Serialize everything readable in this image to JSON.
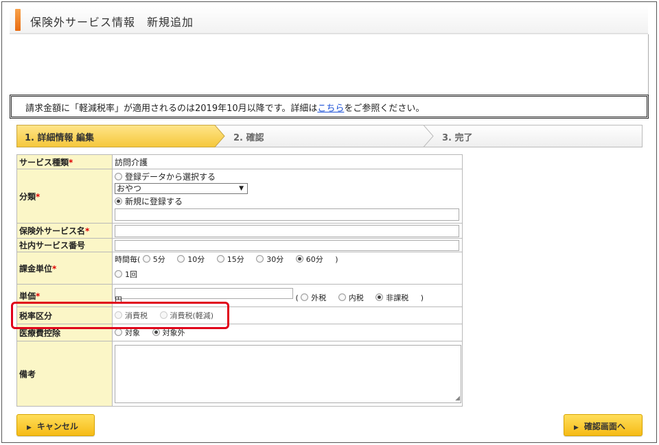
{
  "header": {
    "title": "保険外サービス情報　新規追加"
  },
  "notice": {
    "before_link": "請求金額に「軽減税率」が適用されるのは2019年10月以降です。詳細は",
    "link_text": "こちら",
    "after_link": "をご参照ください。"
  },
  "steps": [
    {
      "label": "1. 詳細情報 編集",
      "state": "active"
    },
    {
      "label": "2. 確認",
      "state": "inactive"
    },
    {
      "label": "3. 完了",
      "state": "inactive"
    }
  ],
  "form": {
    "service_type": {
      "label": "サービス種類",
      "required_mark": "*",
      "value": "訪問介護"
    },
    "category": {
      "label": "分類",
      "required_mark": "*",
      "option_select_existing": "登録データから選択する",
      "selected_value": "おやつ",
      "option_register_new": "新規に登録する",
      "new_value": ""
    },
    "service_name": {
      "label": "保険外サービス名",
      "required_mark": "*",
      "value": ""
    },
    "internal_number": {
      "label": "社内サービス番号",
      "value": ""
    },
    "billing_unit": {
      "label": "課金単位",
      "required_mark": "*",
      "prefix": "時間毎(",
      "options": [
        "5分",
        "10分",
        "15分",
        "30分",
        "60分"
      ],
      "selected": "60分",
      "suffix": ")",
      "once_option": "1回"
    },
    "unit_price": {
      "label": "単価",
      "required_mark": "*",
      "value": "",
      "currency": "円",
      "open_paren": "(",
      "tax_options": [
        "外税",
        "内税",
        "非課税"
      ],
      "selected": "非課税",
      "close_paren": ")"
    },
    "tax_rate": {
      "label": "税率区分",
      "options": [
        "消費税",
        "消費税(軽減)"
      ]
    },
    "medical_deduction": {
      "label": "医療費控除",
      "options": [
        "対象",
        "対象外"
      ],
      "selected": "対象外"
    },
    "remarks": {
      "label": "備考",
      "value": ""
    }
  },
  "buttons": {
    "cancel": "キャンセル",
    "confirm": "確認画面へ"
  },
  "colors": {
    "accent_orange": "#f08a2c",
    "label_bg": "#fbf6c7",
    "button_yellow": "#f9c928",
    "highlight_red": "#e0001a",
    "link_blue": "#1a4fd6"
  }
}
